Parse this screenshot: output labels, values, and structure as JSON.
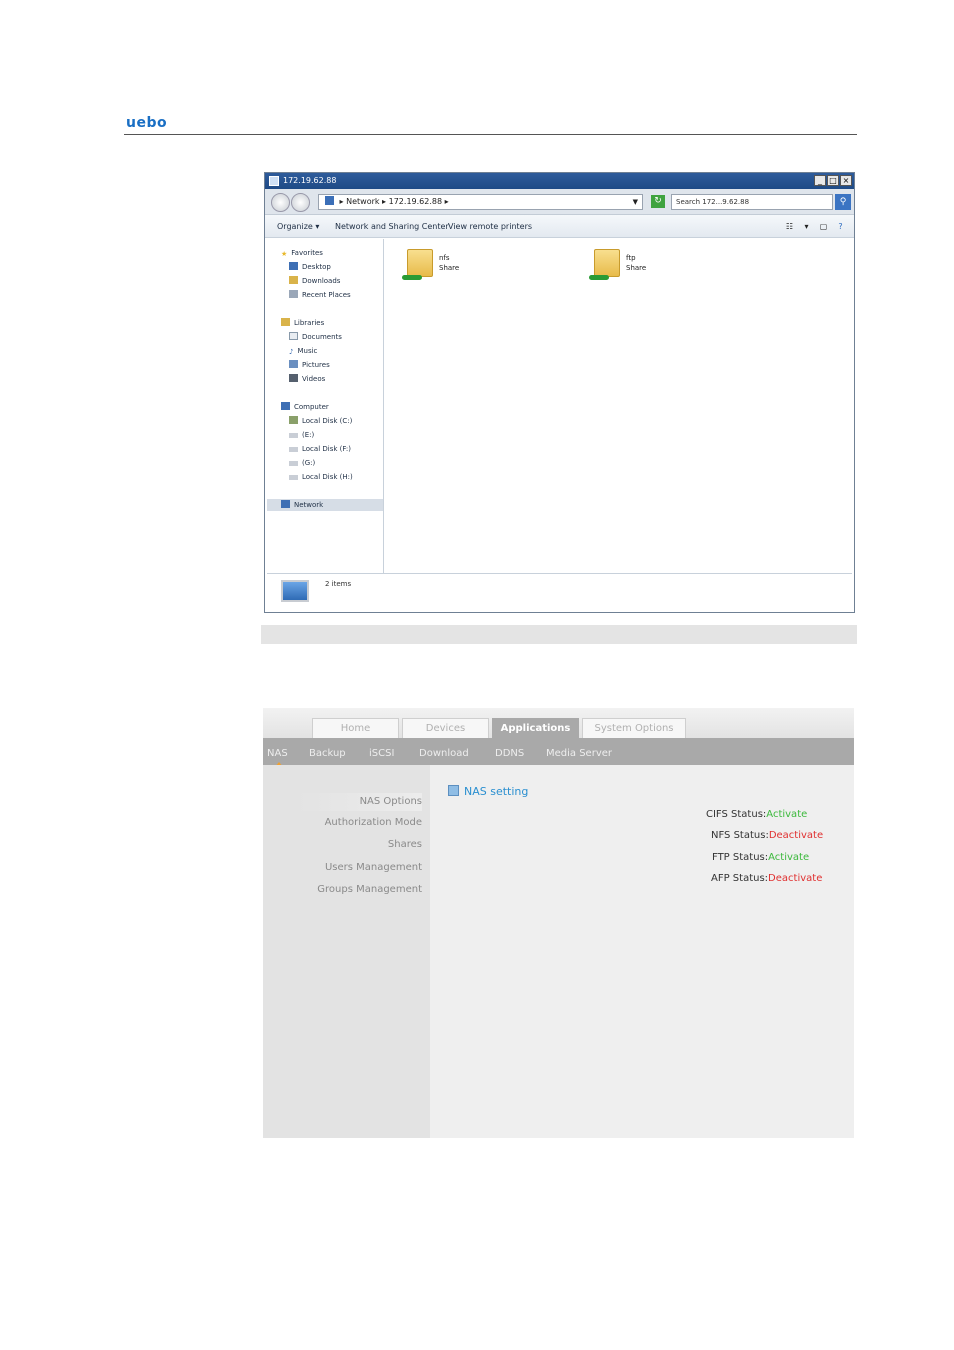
{
  "header": {
    "logo": "uebo"
  },
  "explorer": {
    "title": "172.19.62.88",
    "address": {
      "segment1": "Network",
      "segment2": "172.19.62.88"
    },
    "search_placeholder": "Search 172...9.62.88",
    "toolbar": {
      "organize": "Organize",
      "network_center": "Network and Sharing Center",
      "remote_printers": "View remote printers"
    },
    "nav": {
      "favorites": "Favorites",
      "favorites_items": [
        "Desktop",
        "Downloads",
        "Recent Places"
      ],
      "libraries": "Libraries",
      "libraries_items": [
        "Documents",
        "Music",
        "Pictures",
        "Videos"
      ],
      "computer": "Computer",
      "computer_items": [
        "Local Disk (C:)",
        "(E:)",
        "Local Disk (F:)",
        "(G:)",
        "Local Disk (H:)"
      ],
      "network": "Network"
    },
    "shares": [
      {
        "name": "nfs",
        "type": "Share"
      },
      {
        "name": "ftp",
        "type": "Share"
      }
    ],
    "status": "2 items"
  },
  "webui": {
    "tabs": [
      "Home",
      "Devices",
      "Applications",
      "System Options"
    ],
    "active_tab": "Applications",
    "subnav": [
      "NAS",
      "Backup",
      "iSCSI",
      "Download",
      "DDNS",
      "Media Server"
    ],
    "active_subnav": "NAS",
    "left_menu": [
      "NAS Options",
      "Authorization Mode",
      "Shares",
      "Users Management",
      "Groups Management"
    ],
    "active_menu": "NAS Options",
    "panel_title": "NAS setting",
    "statuses": [
      {
        "label": "CIFS Status:",
        "value": "Activate",
        "state": "on"
      },
      {
        "label": "NFS Status:",
        "value": "Deactivate",
        "state": "off"
      },
      {
        "label": "FTP Status:",
        "value": "Activate",
        "state": "on"
      },
      {
        "label": "AFP Status:",
        "value": "Deactivate",
        "state": "off"
      }
    ],
    "colors": {
      "activate": "#3cb93c",
      "deactivate": "#e03030",
      "title": "#2a8fd0",
      "active_tab": "#a9a9a9"
    }
  }
}
